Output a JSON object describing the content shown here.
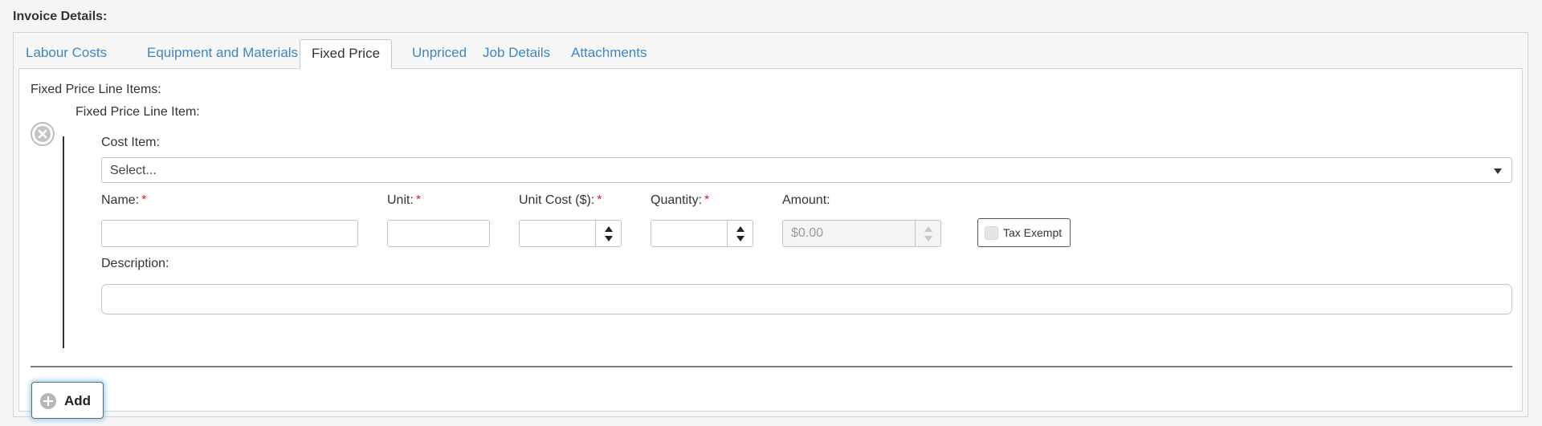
{
  "section": {
    "title": "Invoice Details:"
  },
  "tabs": [
    {
      "label": "Labour Costs",
      "active": false
    },
    {
      "label": "Equipment and Materials",
      "active": false
    },
    {
      "label": "Fixed Price",
      "active": true
    },
    {
      "label": "Unpriced",
      "active": false
    },
    {
      "label": "Job Details",
      "active": false
    },
    {
      "label": "Attachments",
      "active": false
    }
  ],
  "fixed_price": {
    "list_label": "Fixed Price Line Items:",
    "item": {
      "title": "Fixed Price Line Item:",
      "cost_item": {
        "label": "Cost Item:",
        "value": "Select..."
      },
      "name": {
        "label": "Name:",
        "required": "*",
        "value": ""
      },
      "unit": {
        "label": "Unit:",
        "required": "*",
        "value": ""
      },
      "unit_cost": {
        "label": "Unit Cost ($):",
        "required": "*",
        "value": ""
      },
      "quantity": {
        "label": "Quantity:",
        "required": "*",
        "value": ""
      },
      "amount": {
        "label": "Amount:",
        "value": "$0.00"
      },
      "tax_exempt": {
        "label": "Tax Exempt",
        "checked": false
      },
      "description": {
        "label": "Description:",
        "value": ""
      }
    },
    "add_button": {
      "label": "Add"
    }
  },
  "colors": {
    "link": "#3c86c4",
    "required": "#d0262c",
    "focus_glow": "#9ccdf0"
  },
  "icons": {
    "remove": "circle-x-icon",
    "add": "plus-circle-icon",
    "caret": "caret-down-icon"
  }
}
